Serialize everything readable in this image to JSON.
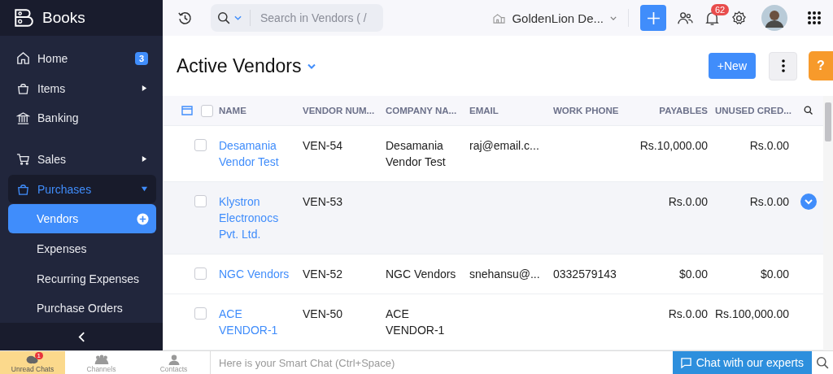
{
  "app": {
    "name": "Books"
  },
  "sidebar": {
    "items": [
      {
        "label": "Home",
        "badge": "3"
      },
      {
        "label": "Items",
        "expanded": false
      },
      {
        "label": "Banking"
      },
      {
        "label": "Sales",
        "expanded": false
      },
      {
        "label": "Purchases",
        "expanded": true,
        "selected": true,
        "children": [
          {
            "label": "Vendors",
            "selected": true
          },
          {
            "label": "Expenses",
            "selected": false
          },
          {
            "label": "Recurring Expenses",
            "selected": false
          },
          {
            "label": "Purchase Orders",
            "selected": false
          }
        ]
      }
    ]
  },
  "topbar": {
    "search": {
      "placeholder": "Search in Vendors ( /"
    },
    "organization": "GoldenLion De...",
    "notifications": "62"
  },
  "page": {
    "title": "Active Vendors",
    "new_button": "+New",
    "help_button": "?"
  },
  "table": {
    "select_all_checked": false,
    "columns": [
      "NAME",
      "VENDOR NUM...",
      "COMPANY NA...",
      "EMAIL",
      "WORK PHONE",
      "PAYABLES",
      "UNUSED CRED..."
    ],
    "rows": [
      {
        "name": "Desamania Vendor Test",
        "vendor_number": "VEN-54",
        "company": "Desamania Vendor Test",
        "email": "raj@email.c...",
        "work_phone": "",
        "payables": "Rs.10,000.00",
        "unused_credits": "Rs.0.00",
        "checked": false,
        "selected": false
      },
      {
        "name": "Klystron Electronocs Pvt. Ltd.",
        "vendor_number": "VEN-53",
        "company": "",
        "email": "",
        "work_phone": "",
        "payables": "Rs.0.00",
        "unused_credits": "Rs.0.00",
        "checked": false,
        "selected": true
      },
      {
        "name": "NGC Vendors",
        "vendor_number": "VEN-52",
        "company": "NGC Vendors",
        "email": "snehansu@...",
        "work_phone": "0332579143",
        "payables": "$0.00",
        "unused_credits": "$0.00",
        "checked": false,
        "selected": false
      },
      {
        "name": "ACE VENDOR-1",
        "vendor_number": "VEN-50",
        "company": "ACE VENDOR-1",
        "email": "",
        "work_phone": "",
        "payables": "Rs.0.00",
        "unused_credits": "Rs.100,000.00",
        "checked": false,
        "selected": false
      }
    ]
  },
  "bottom_bar": {
    "tabs": [
      {
        "label": "Unread Chats",
        "badge": "1",
        "selected": true
      },
      {
        "label": "Channels",
        "selected": false
      },
      {
        "label": "Contacts",
        "selected": false
      }
    ],
    "chat": {
      "placeholder": "Here is your Smart Chat (Ctrl+Space)"
    },
    "experts_button": "Chat with our experts"
  }
}
